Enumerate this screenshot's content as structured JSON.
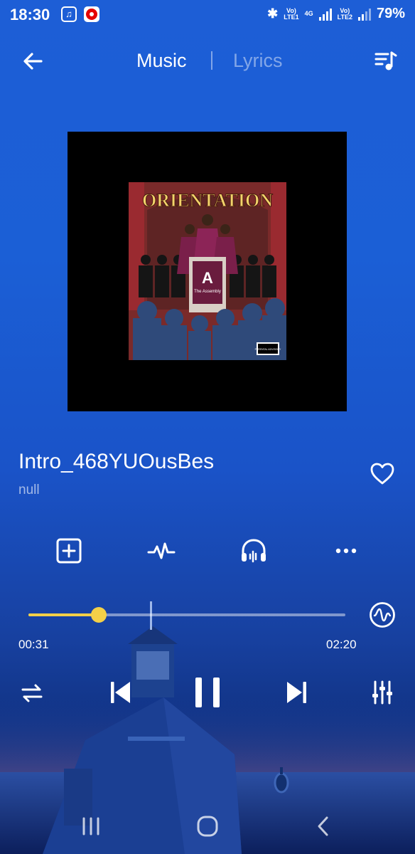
{
  "status_bar": {
    "time": "18:30",
    "sim1_label": "Vo)\nLTE1",
    "net_label": "4G",
    "sim2_label": "Vo)\nLTE2",
    "battery": "79%",
    "icons": [
      "music-app-icon",
      "vodafone-icon",
      "bluetooth-icon",
      "signal-icon"
    ]
  },
  "header": {
    "tab_music": "Music",
    "tab_lyrics": "Lyrics"
  },
  "album": {
    "cover_title": "ORIENTATION",
    "podium_letter": "A",
    "podium_sub": "The Assembly",
    "advisory": "PARENTAL ADVISORY"
  },
  "song": {
    "title": "Intro_468YUOusBes",
    "artist": "null"
  },
  "player": {
    "current_time": "00:31",
    "total_time": "02:20",
    "progress": 0.222
  },
  "colors": {
    "accent": "#f3d048",
    "bg_top": "#1d5ed6",
    "bg_bottom": "#0b2466"
  }
}
